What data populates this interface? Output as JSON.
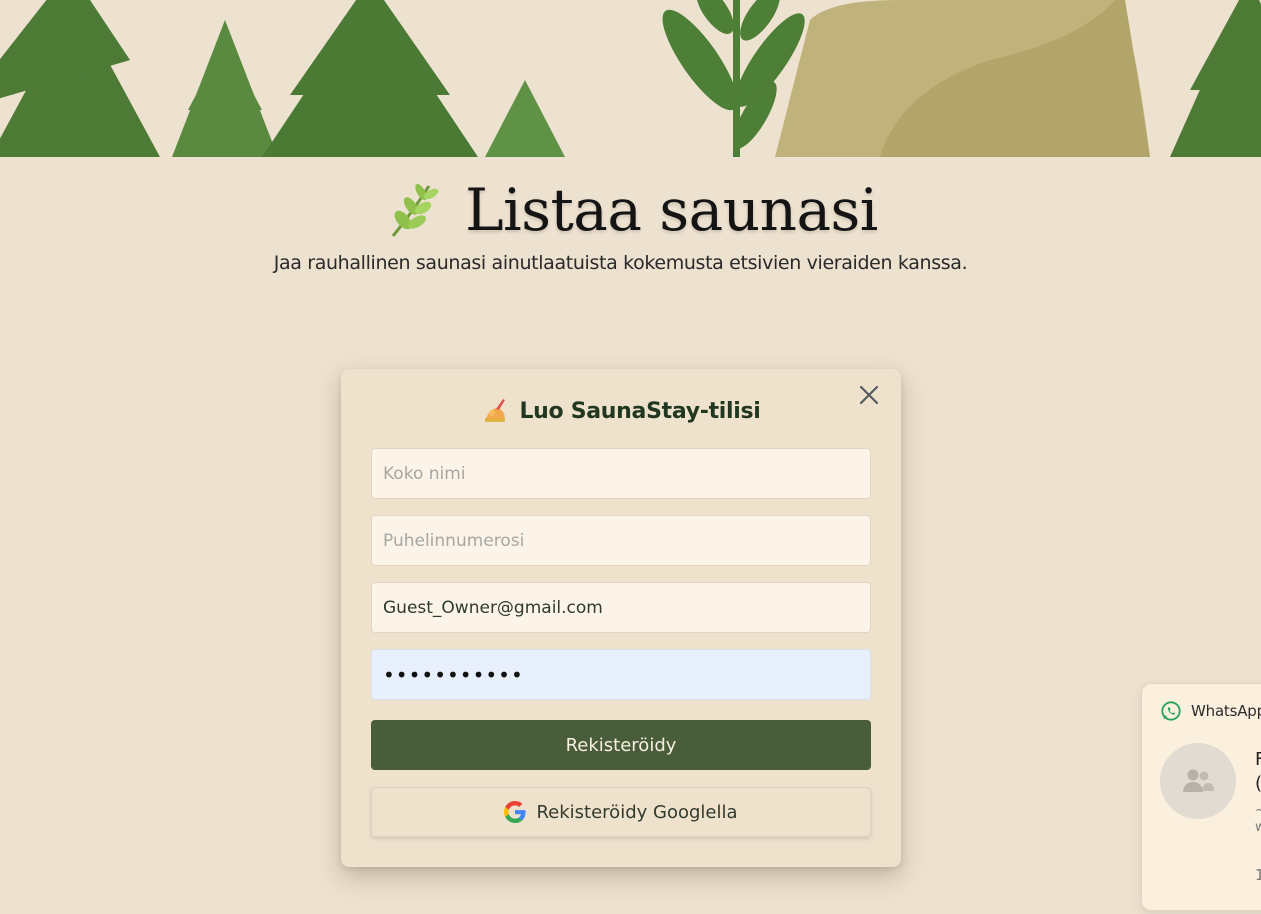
{
  "hero": {
    "title": "Listaa saunasi",
    "subtitle": "Jaa rauhallinen saunasi ainutlaatuista kokemusta etsivien vieraiden kanssa.",
    "title_icon": "herb-leaf-icon"
  },
  "modal": {
    "title": "Luo SaunaStay-tilisi",
    "title_icon": "writing-hand-icon",
    "close_icon": "close-icon",
    "fields": {
      "name_placeholder": "Koko nimi",
      "name_value": "",
      "phone_placeholder": "Puhelinnumerosi",
      "phone_value": "",
      "email_value": "Guest_Owner@gmail.com",
      "password_value": "•••••••••••"
    },
    "register_label": "Rekisteröidy",
    "google_label": "Rekisteröidy Googlella",
    "google_icon": "google-g-icon"
  },
  "whatsapp_widget": {
    "label": "WhatsApp",
    "name_line1": "F",
    "name_line2": "(",
    "sub_line1": "~",
    "sub_line2": "w",
    "time": "1",
    "icons": [
      "whatsapp-icon",
      "group-avatar-icon"
    ]
  },
  "colors": {
    "background": "#ede1cf",
    "modal_bg": "#efe2cd",
    "primary_button": "#4a5d3b",
    "tree_green": "#4f7a37",
    "autofill_blue": "#e8f0fe"
  }
}
